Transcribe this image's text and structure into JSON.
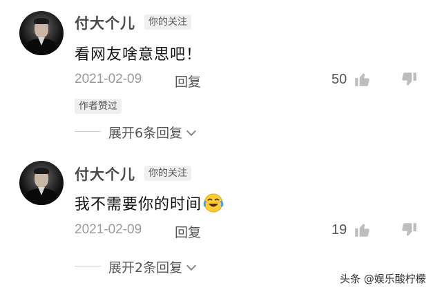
{
  "comments": [
    {
      "username": "付大个儿",
      "badge": "你的关注",
      "text": "看网友啥意思吧！",
      "date": "2021-02-09",
      "reply_label": "回复",
      "likes": "50",
      "author_liked_label": "作者赞过",
      "expand_replies_label": "展开6条回复"
    },
    {
      "username": "付大个儿",
      "badge": "你的关注",
      "text": "我不需要你的时间",
      "emoji": "laughing-crying-emoji",
      "date": "2021-02-09",
      "reply_label": "回复",
      "likes": "19",
      "expand_replies_label": "展开2条回复"
    }
  ],
  "watermark": "头条 @娱乐酸柠檬",
  "icons": {
    "like": "thumbs-up-icon",
    "dislike": "thumbs-down-icon",
    "expand": "chevron-down-icon"
  },
  "colors": {
    "text_primary": "#111111",
    "text_secondary": "#9a9a9a",
    "badge_bg": "#f0f0f0"
  }
}
